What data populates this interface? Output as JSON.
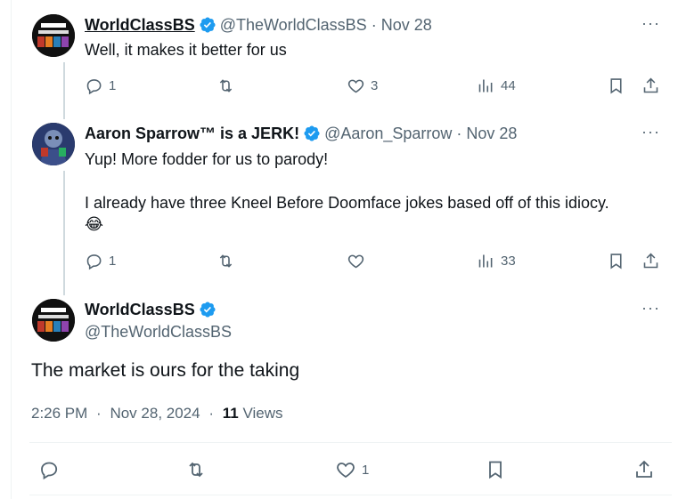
{
  "tweets": [
    {
      "display_name": "WorldClassBS",
      "handle": "@TheWorldClassBS",
      "separator": "·",
      "date": "Nov 28",
      "text": "Well, it makes it better for us",
      "actions": {
        "replies": "1",
        "reposts": "",
        "likes": "3",
        "views": "44"
      }
    },
    {
      "display_name": "Aaron Sparrow™ is a JERK!",
      "handle": "@Aaron_Sparrow",
      "separator": "·",
      "date": "Nov 28",
      "text_line1": "Yup! More fodder for us to parody!",
      "text_line2": "I already have three Kneel Before Doomface jokes based off of this idiocy.",
      "emoji": "😂",
      "actions": {
        "replies": "1",
        "reposts": "",
        "likes": "",
        "views": "33"
      }
    }
  ],
  "main_tweet": {
    "display_name": "WorldClassBS",
    "handle": "@TheWorldClassBS",
    "text": "The market is ours for the taking",
    "time": "2:26 PM",
    "separator": "·",
    "date": "Nov 28, 2024",
    "separator2": "·",
    "views_count": "11",
    "views_label": " Views",
    "actions": {
      "replies": "",
      "reposts": "",
      "likes": "1"
    }
  },
  "more_label": "···",
  "colors": {
    "accent": "#1d9bf0",
    "secondary_text": "#536471",
    "thread_line": "#cfd9de"
  }
}
